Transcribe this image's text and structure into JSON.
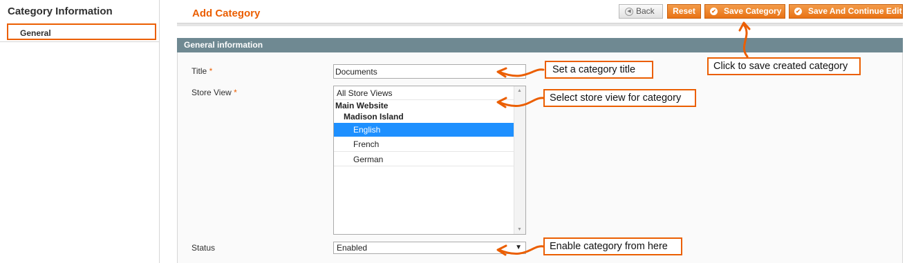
{
  "sidebar": {
    "title": "Category Information",
    "tabs": [
      {
        "label": "General",
        "active": true
      }
    ]
  },
  "header": {
    "title": "Add Category",
    "buttons": {
      "back": "Back",
      "reset": "Reset",
      "save": "Save Category",
      "save_continue": "Save And Continue Edit"
    }
  },
  "fieldset": {
    "title": "General information",
    "fields": {
      "title": {
        "label": "Title",
        "required_mark": "*",
        "value": "Documents"
      },
      "store_view": {
        "label": "Store View",
        "required_mark": "*",
        "options": {
          "all": "All Store Views",
          "website": "Main Website",
          "store": "Madison Island",
          "views": [
            "English",
            "French",
            "German"
          ]
        },
        "selected": "English"
      },
      "status": {
        "label": "Status",
        "value": "Enabled"
      }
    }
  },
  "annotations": {
    "title": "Set a category title",
    "store_view": "Select store view for category",
    "save": "Click to save created category",
    "status": "Enable category from here"
  },
  "colors": {
    "accent": "#eb5e00",
    "fieldset_header": "#6f8992",
    "selection": "#1e90ff"
  },
  "icons": {
    "back": "back-arrow-icon",
    "save": "check-circle-icon",
    "dropdown": "chevron-down-icon"
  }
}
